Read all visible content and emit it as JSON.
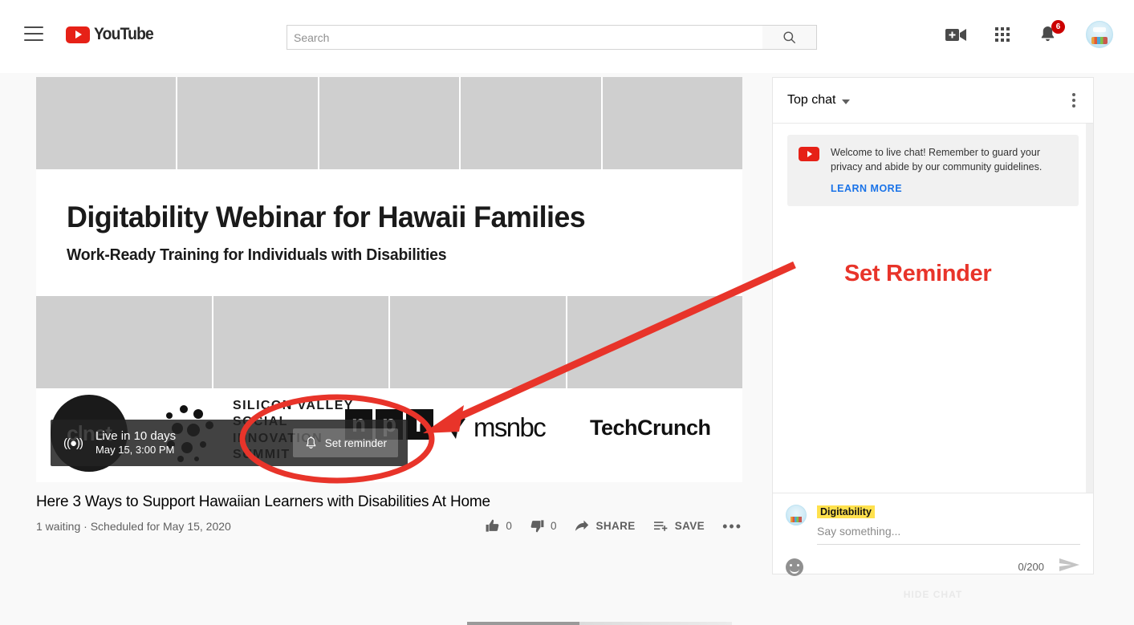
{
  "header": {
    "menu_icon": "hamburger-menu-icon",
    "logo_text": "YouTube",
    "search": {
      "value": "",
      "placeholder": "Search"
    },
    "search_button_icon": "search-icon",
    "create_icon": "video-camera-plus-icon",
    "apps_icon": "apps-grid-icon",
    "notifications_icon": "bell-icon",
    "notifications_badge": "6",
    "avatar_icon": "account-avatar"
  },
  "video": {
    "banner_title": "Digitability Webinar for Hawaii Families",
    "banner_subtitle": "Work-Ready Training for Individuals with Disabilities",
    "sponsor_logos": [
      {
        "name": "cnet",
        "label": "c|net"
      },
      {
        "name": "silicon-valley-social-innovation-summit",
        "lines": [
          "SILICON VALLEY",
          "SOCIAL",
          "INNOVATION",
          "SUMMIT"
        ]
      },
      {
        "name": "npr",
        "letters": [
          "n",
          "p",
          "r"
        ]
      },
      {
        "name": "msnbc",
        "label": "msnbc"
      },
      {
        "name": "techcrunch",
        "label": "TechCrunch"
      }
    ],
    "live_badge_icon": "live-broadcast-icon",
    "live_line1": "Live in 10 days",
    "live_line2": "May 15, 3:00 PM",
    "reminder_button_label": "Set reminder",
    "reminder_button_icon": "bell-icon",
    "title": "Here 3 Ways to Support Hawaiian Learners with Disabilities At Home",
    "meta": "1 waiting · Scheduled for May 15, 2020",
    "actions": {
      "like_label": "",
      "like_count": "0",
      "dislike_label": "",
      "dislike_count": "0",
      "share_label": "SHARE",
      "save_label": "SAVE",
      "more_label": "•••"
    }
  },
  "chat": {
    "mode_label": "Top chat",
    "menu_icon": "more-vertical-icon",
    "welcome_message": "Welcome to live chat! Remember to guard your privacy and abide by our community guidelines.",
    "learn_more_label": "LEARN MORE",
    "username": "Digitability",
    "input_value": "",
    "input_placeholder": "Say something...",
    "emoji_icon": "emoji-face-icon",
    "char_counter": "0/200",
    "send_icon": "send-arrow-icon",
    "hide_chat_label": "HIDE CHAT"
  },
  "annotation": {
    "label": "Set Reminder",
    "color": "#e8342a",
    "shapes": [
      "ellipse-highlight",
      "arrow-pointer"
    ]
  }
}
